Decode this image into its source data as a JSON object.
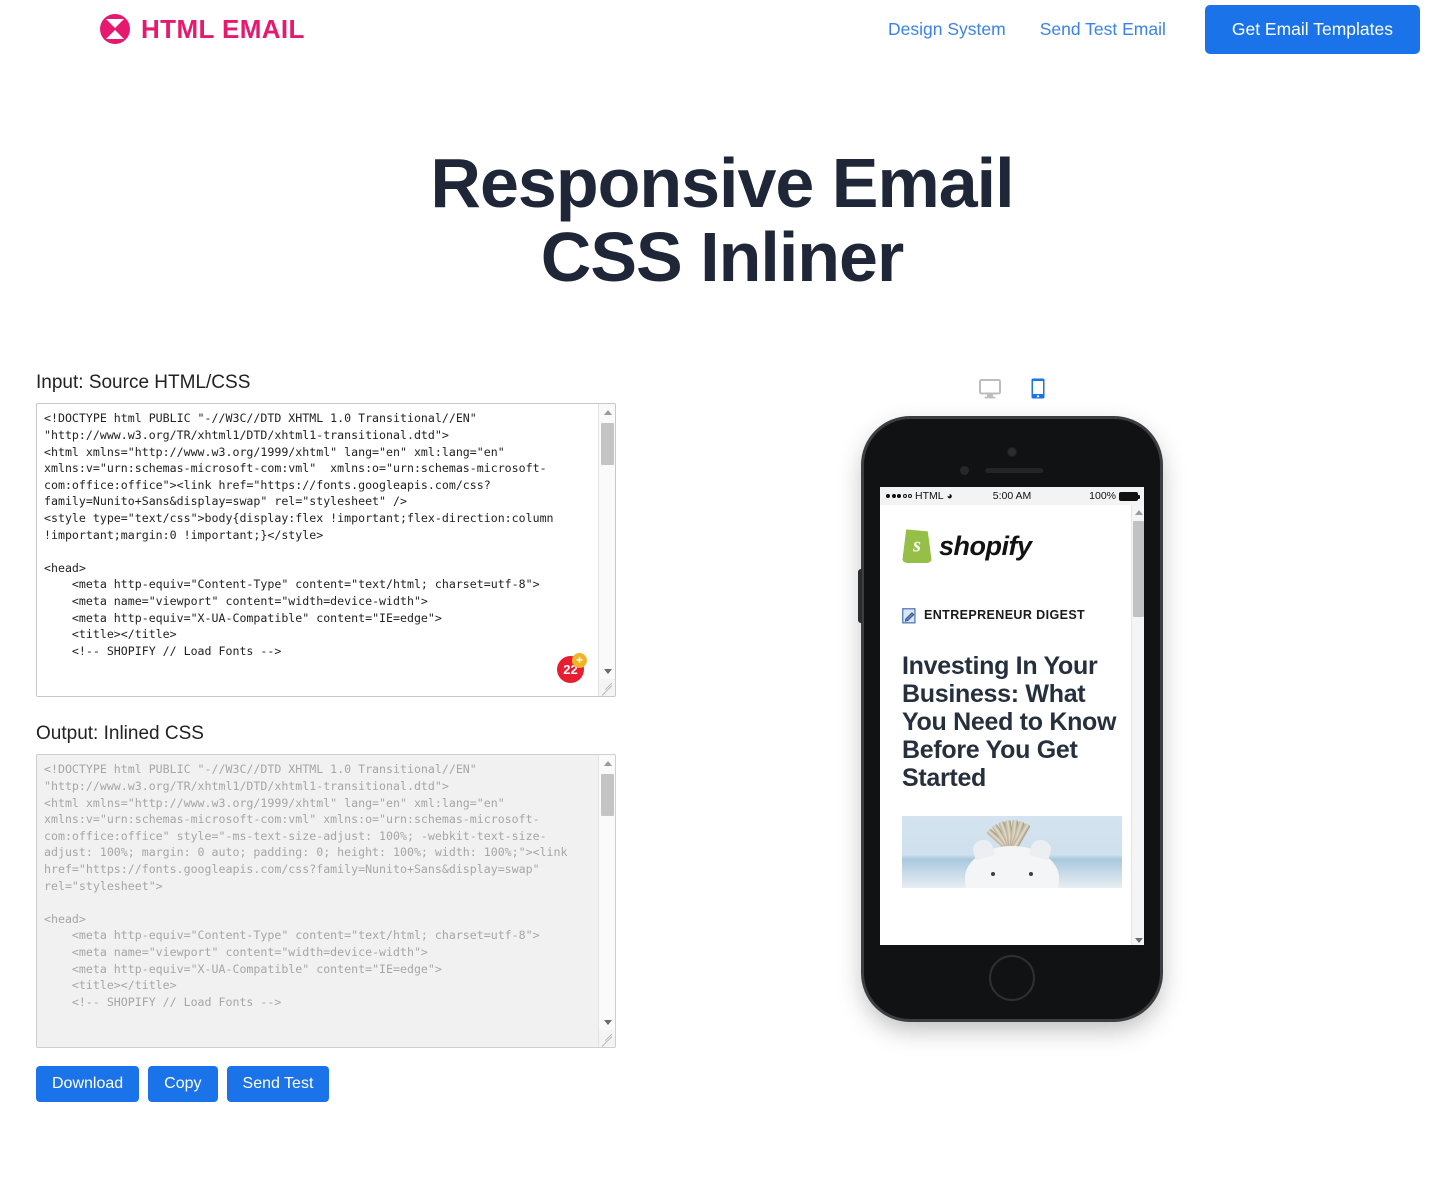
{
  "header": {
    "brand": "HTML EMAIL",
    "nav": [
      {
        "label": "Design System"
      },
      {
        "label": "Send Test Email"
      }
    ],
    "cta": "Get Email Templates",
    "brand_color": "#e6196e",
    "accent_color": "#1a73e8"
  },
  "hero": {
    "line1": "Responsive Email",
    "line2": "CSS Inliner"
  },
  "editor": {
    "input_label": "Input: Source HTML/CSS",
    "output_label": "Output: Inlined CSS",
    "input_value": "<!DOCTYPE html PUBLIC \"-//W3C//DTD XHTML 1.0 Transitional//EN\" \"http://www.w3.org/TR/xhtml1/DTD/xhtml1-transitional.dtd\">\n<html xmlns=\"http://www.w3.org/1999/xhtml\" lang=\"en\" xml:lang=\"en\" xmlns:v=\"urn:schemas-microsoft-com:vml\"  xmlns:o=\"urn:schemas-microsoft-com:office:office\"><link href=\"https://fonts.googleapis.com/css?family=Nunito+Sans&display=swap\" rel=\"stylesheet\" />\n<style type=\"text/css\">body{display:flex !important;flex-direction:column !important;margin:0 !important;}</style>\n\n<head>\n    <meta http-equiv=\"Content-Type\" content=\"text/html; charset=utf-8\">\n    <meta name=\"viewport\" content=\"width=device-width\">\n    <meta http-equiv=\"X-UA-Compatible\" content=\"IE=edge\">\n    <title></title>\n    <!-- SHOPIFY // Load Fonts -->",
    "output_value": "<!DOCTYPE html PUBLIC \"-//W3C//DTD XHTML 1.0 Transitional//EN\" \"http://www.w3.org/TR/xhtml1/DTD/xhtml1-transitional.dtd\">\n<html xmlns=\"http://www.w3.org/1999/xhtml\" lang=\"en\" xml:lang=\"en\" xmlns:v=\"urn:schemas-microsoft-com:vml\" xmlns:o=\"urn:schemas-microsoft-com:office:office\" style=\"-ms-text-size-adjust: 100%; -webkit-text-size-adjust: 100%; margin: 0 auto; padding: 0; height: 100%; width: 100%;\"><link href=\"https://fonts.googleapis.com/css?family=Nunito+Sans&display=swap\" rel=\"stylesheet\">\n\n<head>\n    <meta http-equiv=\"Content-Type\" content=\"text/html; charset=utf-8\">\n    <meta name=\"viewport\" content=\"width=device-width\">\n    <meta http-equiv=\"X-UA-Compatible\" content=\"IE=edge\">\n    <title></title>\n    <!-- SHOPIFY // Load Fonts -->",
    "grammarly_count": "22",
    "grammarly_plus": "+"
  },
  "actions": [
    {
      "label": "Download"
    },
    {
      "label": "Copy"
    },
    {
      "label": "Send Test"
    }
  ],
  "preview": {
    "devices": [
      {
        "name": "desktop",
        "active": false
      },
      {
        "name": "mobile",
        "active": true
      }
    ],
    "status_bar": {
      "carrier": "HTML",
      "time": "5:00 AM",
      "battery": "100%"
    },
    "email": {
      "logo_text": "shopify",
      "kicker": "ENTREPRENEUR DIGEST",
      "headline": "Investing In Your Business: What You Need to Know Before You Get Started"
    }
  }
}
